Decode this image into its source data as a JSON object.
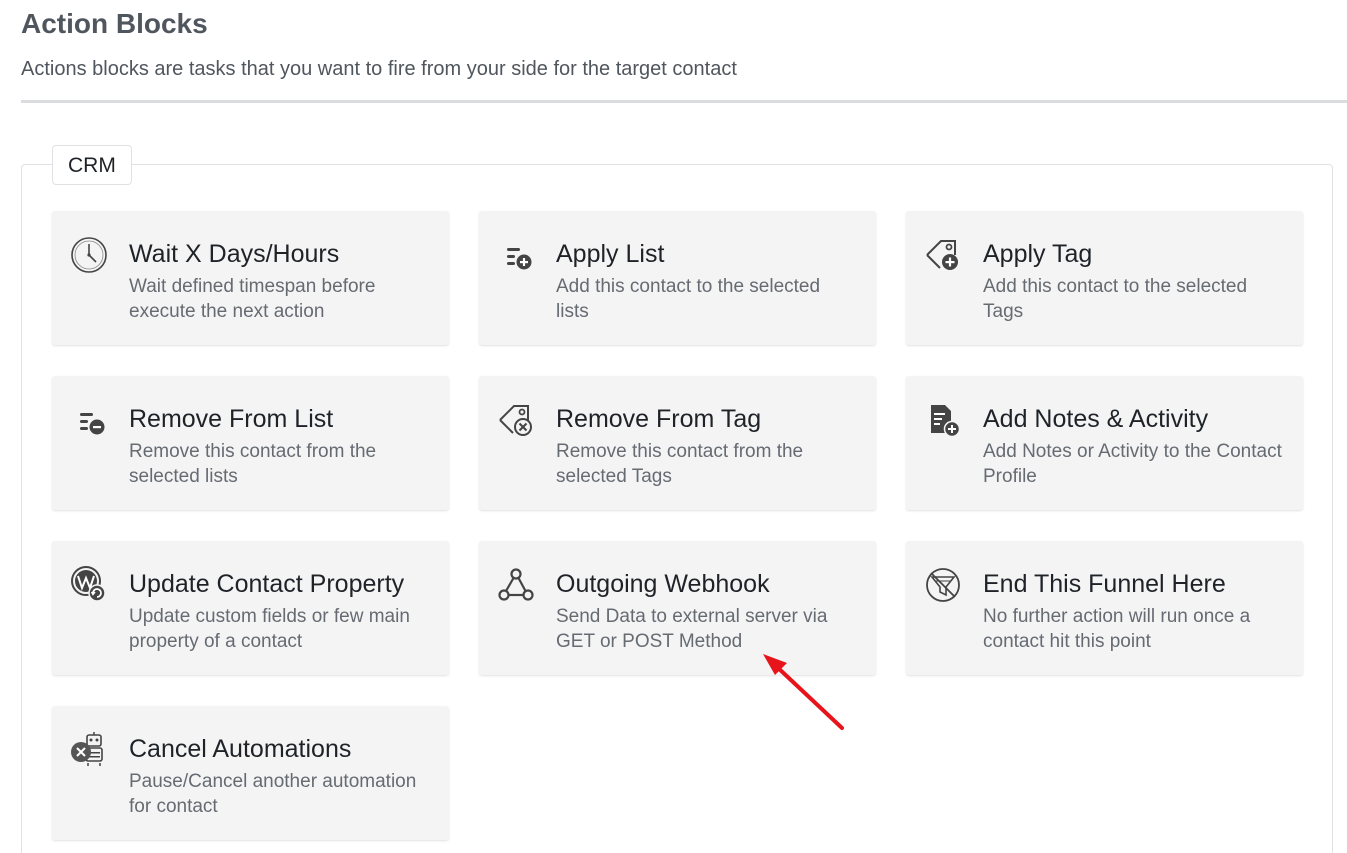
{
  "header": {
    "title": "Action Blocks",
    "subtitle": "Actions blocks are tasks that you want to fire from your side for the target contact"
  },
  "group": {
    "label": "CRM"
  },
  "cards": [
    {
      "title": "Wait X Days/Hours",
      "desc": "Wait defined timespan before execute the next action",
      "icon": "clock-icon"
    },
    {
      "title": "Apply List",
      "desc": "Add this contact to the selected lists",
      "icon": "list-add-icon"
    },
    {
      "title": "Apply Tag",
      "desc": "Add this contact to the selected Tags",
      "icon": "tag-add-icon"
    },
    {
      "title": "Remove From List",
      "desc": "Remove this contact from the selected lists",
      "icon": "list-remove-icon"
    },
    {
      "title": "Remove From Tag",
      "desc": "Remove this contact from the selected Tags",
      "icon": "tag-remove-icon"
    },
    {
      "title": "Add Notes & Activity",
      "desc": "Add Notes or Activity to the Contact Profile",
      "icon": "note-add-icon"
    },
    {
      "title": "Update Contact Property",
      "desc": "Update custom fields or few main property of a contact",
      "icon": "wordpress-sync-icon"
    },
    {
      "title": "Outgoing Webhook",
      "desc": "Send Data to external server via GET or POST Method",
      "icon": "webhook-icon"
    },
    {
      "title": "End This Funnel Here",
      "desc": "No further action will run once a contact hit this point",
      "icon": "funnel-end-icon"
    },
    {
      "title": "Cancel Automations",
      "desc": "Pause/Cancel another automation for contact",
      "icon": "robot-cancel-icon"
    }
  ],
  "annotation": {
    "arrow_color": "#e8141c"
  },
  "colors": {
    "card_bg": "#f4f4f5",
    "title_text": "#1f2328",
    "desc_text": "#666b72",
    "heading_text": "#50565d"
  }
}
